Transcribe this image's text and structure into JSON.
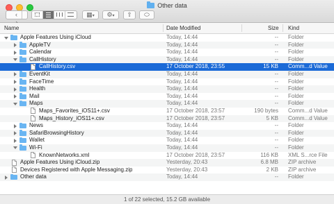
{
  "window": {
    "title": "Other data"
  },
  "toolbar": {
    "back_icon": "‹",
    "forward_icon": "›",
    "view_modes": [
      "icon-view",
      "list-view",
      "column-view",
      "gallery-view"
    ],
    "arrange_icon": "▦",
    "action_icon": "⚙",
    "share_icon": "⇧",
    "tag_icon": "⬭"
  },
  "columns": {
    "name": "Name",
    "date": "Date Modified",
    "size": "Size",
    "kind": "Kind"
  },
  "rows": [
    {
      "name": "Apple Features Using iCloud",
      "date": "Today, 14:44",
      "size": "--",
      "kind": "Folder"
    },
    {
      "name": "AppleTV",
      "date": "Today, 14:44",
      "size": "--",
      "kind": "Folder"
    },
    {
      "name": "Calendar",
      "date": "Today, 14:44",
      "size": "--",
      "kind": "Folder"
    },
    {
      "name": "CallHistory",
      "date": "Today, 14:44",
      "size": "--",
      "kind": "Folder"
    },
    {
      "name": "CallHistory.csv",
      "date": "17 October 2018, 23:55",
      "size": "15 KB",
      "kind": "Comm...d Value"
    },
    {
      "name": "EventKit",
      "date": "Today, 14:44",
      "size": "--",
      "kind": "Folder"
    },
    {
      "name": "FaceTime",
      "date": "Today, 14:44",
      "size": "--",
      "kind": "Folder"
    },
    {
      "name": "Health",
      "date": "Today, 14:44",
      "size": "--",
      "kind": "Folder"
    },
    {
      "name": "Mail",
      "date": "Today, 14:44",
      "size": "--",
      "kind": "Folder"
    },
    {
      "name": "Maps",
      "date": "Today, 14:44",
      "size": "--",
      "kind": "Folder"
    },
    {
      "name": "Maps_Favorites_iOS11+.csv",
      "date": "17 October 2018, 23:57",
      "size": "190 bytes",
      "kind": "Comm...d Value"
    },
    {
      "name": "Maps_History_iOS11+.csv",
      "date": "17 October 2018, 23:57",
      "size": "5 KB",
      "kind": "Comm...d Value"
    },
    {
      "name": "News",
      "date": "Today, 14:44",
      "size": "--",
      "kind": "Folder"
    },
    {
      "name": "SafariBrowsingHistory",
      "date": "Today, 14:44",
      "size": "--",
      "kind": "Folder"
    },
    {
      "name": "Wallet",
      "date": "Today, 14:44",
      "size": "--",
      "kind": "Folder"
    },
    {
      "name": "Wi-Fi",
      "date": "Today, 14:44",
      "size": "--",
      "kind": "Folder"
    },
    {
      "name": "KnownNetworks.xml",
      "date": "17 October 2018, 23:57",
      "size": "116 KB",
      "kind": "XML S...rce File"
    },
    {
      "name": "Apple Features Using iCloud.zip",
      "date": "Yesterday, 20:43",
      "size": "6.8 MB",
      "kind": "ZIP archive"
    },
    {
      "name": "Devices Registered with Apple Messaging.zip",
      "date": "Yesterday, 20:43",
      "size": "2 KB",
      "kind": "ZIP archive"
    },
    {
      "name": "Other data",
      "date": "Today, 14:44",
      "size": "--",
      "kind": "Folder"
    }
  ],
  "status": {
    "text": "1 of 22 selected, 15.2 GB available"
  }
}
